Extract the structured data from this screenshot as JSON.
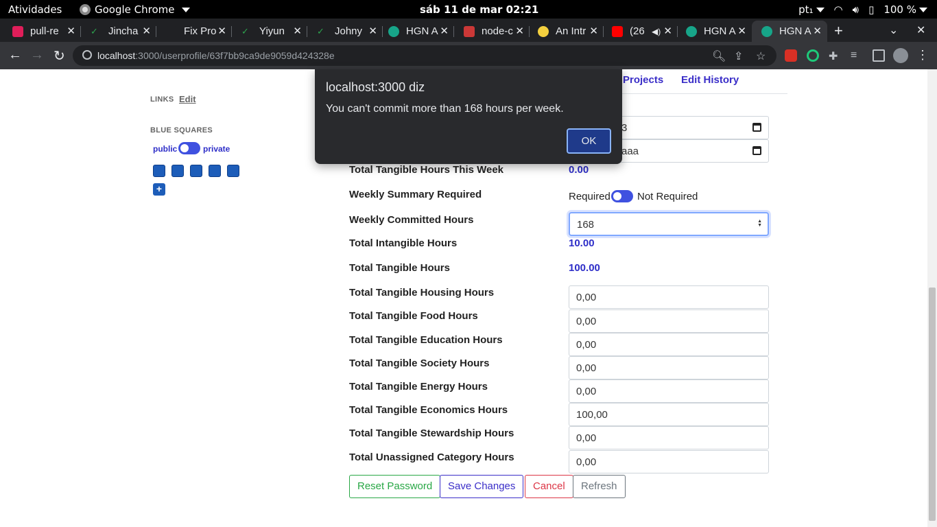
{
  "os_bar": {
    "activities": "Atividades",
    "app_name": "Google Chrome",
    "clock": "sáb 11 de mar  02:21",
    "input_method": "pt₁",
    "battery": "100 %"
  },
  "tabs": [
    {
      "title": "pull-re",
      "icon": "slack-icon",
      "color": "#e01e5a"
    },
    {
      "title": "Jincha",
      "icon": "check-icon",
      "color": "#2da44e"
    },
    {
      "title": "Fix Pro",
      "icon": "github-icon",
      "color": "#202124"
    },
    {
      "title": "Yiyun",
      "icon": "check-icon",
      "color": "#2da44e"
    },
    {
      "title": "Johny",
      "icon": "check-icon",
      "color": "#2da44e"
    },
    {
      "title": "HGN A",
      "icon": "hgn-icon",
      "color": "#17a589"
    },
    {
      "title": "node-c",
      "icon": "npm-icon",
      "color": "#cb3837"
    },
    {
      "title": "An Intr",
      "icon": "smiley-icon",
      "color": "#f4d03f"
    },
    {
      "title": "(26",
      "icon": "youtube-icon",
      "color": "#ff0000"
    },
    {
      "title": "HGN A",
      "icon": "hgn-icon",
      "color": "#17a589"
    },
    {
      "title": "HGN A",
      "icon": "hgn-icon",
      "color": "#17a589"
    }
  ],
  "address_bar": {
    "host": "localhost",
    "rest": ":3000/userprofile/63f7bb9ca9de9059d424328e"
  },
  "sidebar": {
    "links_label": "LINKS",
    "links_edit": "Edit",
    "blue_squares_label": "BLUE SQUARES",
    "public_label": "public",
    "private_label": "private",
    "add_label": "+"
  },
  "profile_tabs": {
    "projects": "Projects",
    "edit_history": "Edit History"
  },
  "date_fields": {
    "start_partial": "3",
    "end_partial": "aaa"
  },
  "rows": {
    "tangible_week_label": "Total Tangible Hours This Week",
    "tangible_week_value": "0.00",
    "summary_required_label": "Weekly Summary Required",
    "required_label": "Required",
    "not_required_label": "Not Required",
    "committed_label": "Weekly Committed Hours",
    "committed_value": "168",
    "intangible_label": "Total Intangible Hours",
    "intangible_value": "10.00",
    "tangible_label": "Total Tangible Hours",
    "tangible_value": "100.00"
  },
  "category_hours": [
    {
      "label": "Total Tangible Housing Hours",
      "value": "0,00"
    },
    {
      "label": "Total Tangible Food Hours",
      "value": "0,00"
    },
    {
      "label": "Total Tangible Education Hours",
      "value": "0,00"
    },
    {
      "label": "Total Tangible Society Hours",
      "value": "0,00"
    },
    {
      "label": "Total Tangible Energy Hours",
      "value": "0,00"
    },
    {
      "label": "Total Tangible Economics Hours",
      "value": "100,00"
    },
    {
      "label": "Total Tangible Stewardship Hours",
      "value": "0,00"
    },
    {
      "label": "Total Unassigned Category Hours",
      "value": "0,00"
    }
  ],
  "buttons": {
    "reset_password": "Reset Password",
    "save_changes": "Save Changes",
    "cancel": "Cancel",
    "refresh": "Refresh"
  },
  "dialog": {
    "title": "localhost:3000 diz",
    "message": "You can't commit more than 168 hours per week.",
    "ok": "OK"
  }
}
